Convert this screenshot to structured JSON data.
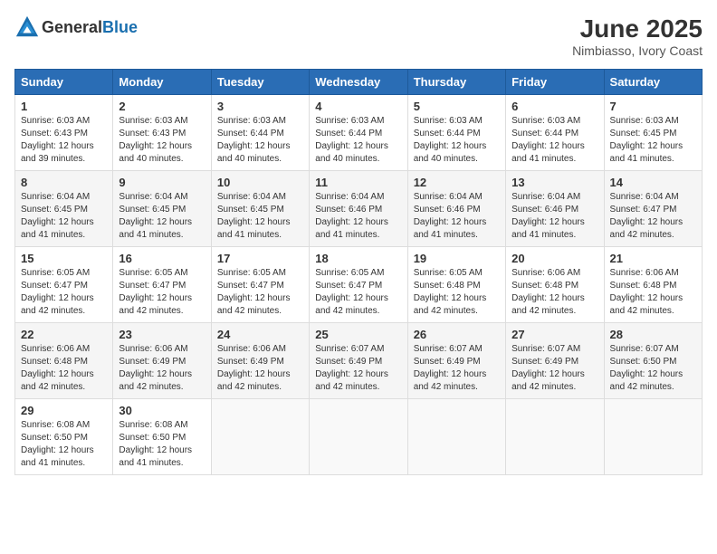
{
  "header": {
    "logo_general": "General",
    "logo_blue": "Blue",
    "month_year": "June 2025",
    "location": "Nimbiasso, Ivory Coast"
  },
  "weekdays": [
    "Sunday",
    "Monday",
    "Tuesday",
    "Wednesday",
    "Thursday",
    "Friday",
    "Saturday"
  ],
  "weeks": [
    [
      {
        "day": "1",
        "sunrise": "6:03 AM",
        "sunset": "6:43 PM",
        "daylight": "12 hours and 39 minutes."
      },
      {
        "day": "2",
        "sunrise": "6:03 AM",
        "sunset": "6:43 PM",
        "daylight": "12 hours and 40 minutes."
      },
      {
        "day": "3",
        "sunrise": "6:03 AM",
        "sunset": "6:44 PM",
        "daylight": "12 hours and 40 minutes."
      },
      {
        "day": "4",
        "sunrise": "6:03 AM",
        "sunset": "6:44 PM",
        "daylight": "12 hours and 40 minutes."
      },
      {
        "day": "5",
        "sunrise": "6:03 AM",
        "sunset": "6:44 PM",
        "daylight": "12 hours and 40 minutes."
      },
      {
        "day": "6",
        "sunrise": "6:03 AM",
        "sunset": "6:44 PM",
        "daylight": "12 hours and 41 minutes."
      },
      {
        "day": "7",
        "sunrise": "6:03 AM",
        "sunset": "6:45 PM",
        "daylight": "12 hours and 41 minutes."
      }
    ],
    [
      {
        "day": "8",
        "sunrise": "6:04 AM",
        "sunset": "6:45 PM",
        "daylight": "12 hours and 41 minutes."
      },
      {
        "day": "9",
        "sunrise": "6:04 AM",
        "sunset": "6:45 PM",
        "daylight": "12 hours and 41 minutes."
      },
      {
        "day": "10",
        "sunrise": "6:04 AM",
        "sunset": "6:45 PM",
        "daylight": "12 hours and 41 minutes."
      },
      {
        "day": "11",
        "sunrise": "6:04 AM",
        "sunset": "6:46 PM",
        "daylight": "12 hours and 41 minutes."
      },
      {
        "day": "12",
        "sunrise": "6:04 AM",
        "sunset": "6:46 PM",
        "daylight": "12 hours and 41 minutes."
      },
      {
        "day": "13",
        "sunrise": "6:04 AM",
        "sunset": "6:46 PM",
        "daylight": "12 hours and 41 minutes."
      },
      {
        "day": "14",
        "sunrise": "6:04 AM",
        "sunset": "6:47 PM",
        "daylight": "12 hours and 42 minutes."
      }
    ],
    [
      {
        "day": "15",
        "sunrise": "6:05 AM",
        "sunset": "6:47 PM",
        "daylight": "12 hours and 42 minutes."
      },
      {
        "day": "16",
        "sunrise": "6:05 AM",
        "sunset": "6:47 PM",
        "daylight": "12 hours and 42 minutes."
      },
      {
        "day": "17",
        "sunrise": "6:05 AM",
        "sunset": "6:47 PM",
        "daylight": "12 hours and 42 minutes."
      },
      {
        "day": "18",
        "sunrise": "6:05 AM",
        "sunset": "6:47 PM",
        "daylight": "12 hours and 42 minutes."
      },
      {
        "day": "19",
        "sunrise": "6:05 AM",
        "sunset": "6:48 PM",
        "daylight": "12 hours and 42 minutes."
      },
      {
        "day": "20",
        "sunrise": "6:06 AM",
        "sunset": "6:48 PM",
        "daylight": "12 hours and 42 minutes."
      },
      {
        "day": "21",
        "sunrise": "6:06 AM",
        "sunset": "6:48 PM",
        "daylight": "12 hours and 42 minutes."
      }
    ],
    [
      {
        "day": "22",
        "sunrise": "6:06 AM",
        "sunset": "6:48 PM",
        "daylight": "12 hours and 42 minutes."
      },
      {
        "day": "23",
        "sunrise": "6:06 AM",
        "sunset": "6:49 PM",
        "daylight": "12 hours and 42 minutes."
      },
      {
        "day": "24",
        "sunrise": "6:06 AM",
        "sunset": "6:49 PM",
        "daylight": "12 hours and 42 minutes."
      },
      {
        "day": "25",
        "sunrise": "6:07 AM",
        "sunset": "6:49 PM",
        "daylight": "12 hours and 42 minutes."
      },
      {
        "day": "26",
        "sunrise": "6:07 AM",
        "sunset": "6:49 PM",
        "daylight": "12 hours and 42 minutes."
      },
      {
        "day": "27",
        "sunrise": "6:07 AM",
        "sunset": "6:49 PM",
        "daylight": "12 hours and 42 minutes."
      },
      {
        "day": "28",
        "sunrise": "6:07 AM",
        "sunset": "6:50 PM",
        "daylight": "12 hours and 42 minutes."
      }
    ],
    [
      {
        "day": "29",
        "sunrise": "6:08 AM",
        "sunset": "6:50 PM",
        "daylight": "12 hours and 41 minutes."
      },
      {
        "day": "30",
        "sunrise": "6:08 AM",
        "sunset": "6:50 PM",
        "daylight": "12 hours and 41 minutes."
      },
      null,
      null,
      null,
      null,
      null
    ]
  ]
}
